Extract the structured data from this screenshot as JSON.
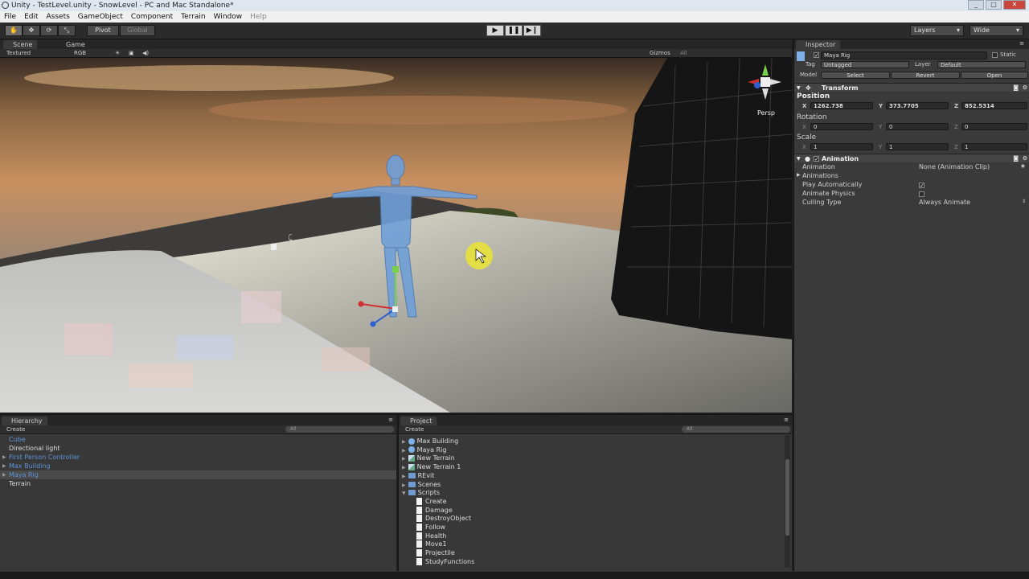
{
  "window": {
    "title": "Unity - TestLevel.unity - SnowLevel - PC and Mac Standalone*"
  },
  "menu": [
    "File",
    "Edit",
    "Assets",
    "GameObject",
    "Component",
    "Terrain",
    "Window",
    "Help"
  ],
  "toolbar": {
    "pivot_label": "Pivot",
    "global_label": "Global",
    "layers_label": "Layers",
    "layout_label": "Wide"
  },
  "scene": {
    "tabs": [
      "Scene",
      "Game"
    ],
    "render_mode": "Textured",
    "color_mode": "RGB",
    "gizmos_label": "Gizmos",
    "search_placeholder": "All",
    "persp_label": "Persp"
  },
  "inspector": {
    "tab_label": "Inspector",
    "object_name": "Maya Rig",
    "static_label": "Static",
    "tag_label": "Tag",
    "tag_value": "Untagged",
    "layer_label": "Layer",
    "layer_value": "Default",
    "model_label": "Model",
    "model_buttons": [
      "Select",
      "Revert",
      "Open"
    ],
    "transform": {
      "title": "Transform",
      "position_label": "Position",
      "position": {
        "x": "1262.738",
        "y": "373.7705",
        "z": "852.5314"
      },
      "rotation_label": "Rotation",
      "rotation": {
        "x": "0",
        "y": "0",
        "z": "0"
      },
      "scale_label": "Scale",
      "scale": {
        "x": "1",
        "y": "1",
        "z": "1"
      }
    },
    "animation": {
      "title": "Animation",
      "rows": [
        {
          "label": "Animation",
          "value": "None (Animation Clip)"
        },
        {
          "label": "Animations",
          "value": ""
        },
        {
          "label": "Play Automatically",
          "value": ""
        },
        {
          "label": "Animate Physics",
          "value": ""
        },
        {
          "label": "Culling Type",
          "value": "Always Animate"
        }
      ],
      "play_automatically": true,
      "animate_physics": false
    }
  },
  "hierarchy": {
    "tab_label": "Hierarchy",
    "create_label": "Create",
    "search_placeholder": "All",
    "items": [
      {
        "name": "Cube",
        "color": "#5e93d8"
      },
      {
        "name": "Directional light",
        "color": "#dcdcdc"
      },
      {
        "name": "First Person Controller",
        "color": "#5e93d8"
      },
      {
        "name": "Max Building",
        "color": "#5e93d8"
      },
      {
        "name": "Maya Rig",
        "color": "#5e93d8"
      },
      {
        "name": "Terrain",
        "color": "#dcdcdc"
      }
    ]
  },
  "project": {
    "tab_label": "Project",
    "create_label": "Create",
    "search_placeholder": "All",
    "items": [
      {
        "name": "Max Building",
        "icon": "prefab-icon",
        "level": 0
      },
      {
        "name": "Maya Rig",
        "icon": "prefab-icon",
        "level": 0
      },
      {
        "name": "New Terrain",
        "icon": "terrain-icon",
        "level": 0
      },
      {
        "name": "New Terrain 1",
        "icon": "terrain-icon",
        "level": 0
      },
      {
        "name": "REvit",
        "icon": "folder-icon",
        "level": 0
      },
      {
        "name": "Scenes",
        "icon": "folder-icon",
        "level": 0
      },
      {
        "name": "Scripts",
        "icon": "folder-icon",
        "level": 0
      },
      {
        "name": "Create",
        "icon": "script-icon",
        "level": 1
      },
      {
        "name": "Damage",
        "icon": "script-icon",
        "level": 1
      },
      {
        "name": "DestroyObject",
        "icon": "script-icon",
        "level": 1
      },
      {
        "name": "Follow",
        "icon": "script-icon",
        "level": 1
      },
      {
        "name": "Health",
        "icon": "script-icon",
        "level": 1
      },
      {
        "name": "Move1",
        "icon": "script-icon",
        "level": 1
      },
      {
        "name": "Projectile",
        "icon": "script-icon",
        "level": 1
      },
      {
        "name": "StudyFunctions",
        "icon": "script-icon",
        "level": 1
      }
    ]
  }
}
